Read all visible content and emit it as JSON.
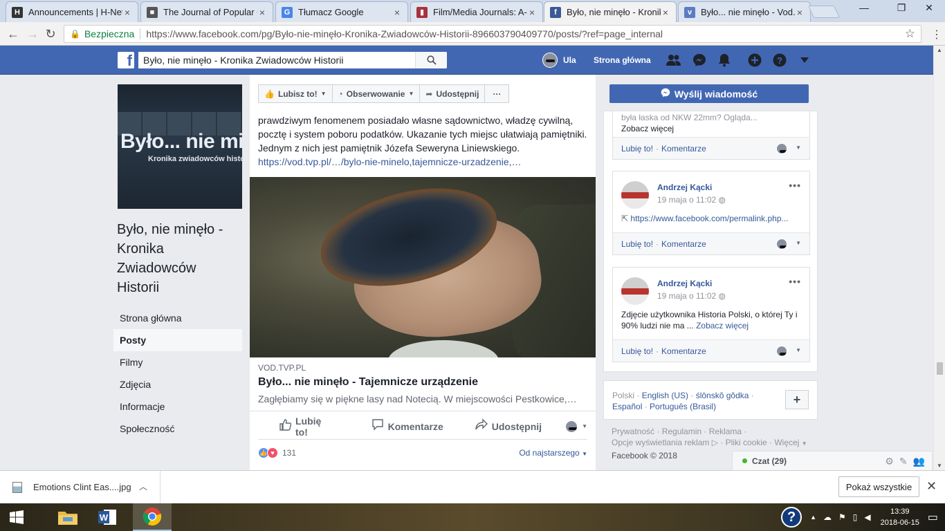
{
  "browser": {
    "tabs": [
      {
        "title": "Announcements | H-Net",
        "favicon_color": "#333333",
        "favicon_text": "H"
      },
      {
        "title": "The Journal of Popular Cu",
        "favicon_color": "#555555",
        "favicon_text": "■"
      },
      {
        "title": "Tłumacz Google",
        "favicon_color": "#4a86e8",
        "favicon_text": "G"
      },
      {
        "title": "Film/Media Journals: A-F",
        "favicon_color": "#a8323e",
        "favicon_text": "▮"
      },
      {
        "title": "Było, nie minęło - Kronika",
        "favicon_color": "#3b5998",
        "favicon_text": "f"
      },
      {
        "title": "Było... nie minęło - Vod.tv",
        "favicon_color": "#5b7bc4",
        "favicon_text": "v"
      }
    ],
    "active_tab": 4,
    "secure_label": "Bezpieczna",
    "url": "https://www.facebook.com/pg/Było-nie-minęło-Kronika-Zwiadowców-Historii-896603790409770/posts/?ref=page_internal"
  },
  "fb": {
    "search_value": "Było, nie minęło - Kronika Zwiadowców Historii",
    "user_name": "Ula",
    "home_label": "Strona główna",
    "brand_color": "#4267b2"
  },
  "page": {
    "cover_title": "Było... nie minęło",
    "cover_subtitle": "Kronika zwiadowców historii",
    "name": "Było, nie minęło - Kronika Zwiadowców Historii",
    "nav": [
      {
        "label": "Strona główna",
        "active": false
      },
      {
        "label": "Posty",
        "active": true
      },
      {
        "label": "Filmy",
        "active": false
      },
      {
        "label": "Zdjęcia",
        "active": false
      },
      {
        "label": "Informacje",
        "active": false
      },
      {
        "label": "Społeczność",
        "active": false
      }
    ]
  },
  "actions": {
    "like": "Lubisz to!",
    "follow": "Obserwowanie",
    "share": "Udostępnij",
    "more": "···",
    "send_message": "Wyślij wiadomość"
  },
  "post": {
    "text": "prawdziwym fenomenem posiadało własne sądownictwo, władzę cywilną, pocztę i system poboru podatków. Ukazanie tych miejsc ułatwiają pamiętniki. Jednym z nich jest pamiętnik Józefa Seweryna Liniewskiego.",
    "link": "https://vod.tvp.pl/…/bylo-nie-minelo,tajemnicze-urzadzenie,…",
    "link_domain": "VOD.TVP.PL",
    "link_title": "Było... nie minęło - Tajemnicze urządzenie",
    "link_desc": "Zagłębiamy się w piękne lasy nad Notecią. W miejscowości Pestkowice,…",
    "like_btn": "Lubię to!",
    "comment_btn": "Komentarze",
    "share_btn": "Udostępnij",
    "reaction_count": "131",
    "sort": "Od najstarszego"
  },
  "right_posts": [
    {
      "body_partial": "była łaska od NKW 22mm? Ogląda...",
      "see_more": "Zobacz więcej",
      "like": "Lubię to!",
      "comment": "Komentarze"
    },
    {
      "author": "Andrzej Kącki",
      "time": "19 maja o 11:02",
      "link": "https://www.facebook.com/permalink.php...",
      "like": "Lubię to!",
      "comment": "Komentarze"
    },
    {
      "author": "Andrzej Kącki",
      "time": "19 maja o 11:02",
      "body": "Zdjęcie użytkownika Historia Polski, o której Ty i 90% ludzi nie ma ...",
      "see_more": "Zobacz więcej",
      "like": "Lubię to!",
      "comment": "Komentarze"
    }
  ],
  "languages": {
    "current": "Polski",
    "others": [
      "English (US)",
      "ślōnskŏ gŏdka",
      "Español",
      "Português (Brasil)"
    ]
  },
  "footer": {
    "links": [
      "Prywatność",
      "Regulamin",
      "Reklama",
      "Opcje wyświetlania reklam",
      "Pliki cookie",
      "Więcej"
    ],
    "copyright": "Facebook © 2018"
  },
  "chat": {
    "label": "Czat (29)"
  },
  "downloads": {
    "file": "Emotions Clint Eas....jpg",
    "show_all": "Pokaż wszystkie"
  },
  "taskbar": {
    "time": "13:39",
    "date": "2018-06-15"
  }
}
